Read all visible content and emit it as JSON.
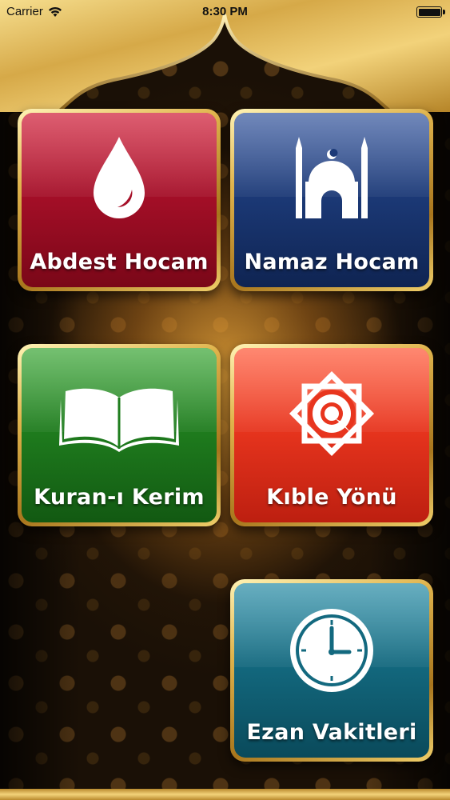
{
  "status_bar": {
    "carrier": "Carrier",
    "time": "8:30 PM"
  },
  "tiles": [
    {
      "label": "Abdest Hocam",
      "icon": "water-drop-icon",
      "color": "#a60f28"
    },
    {
      "label": "Namaz Hocam",
      "icon": "mosque-icon",
      "color": "#1c3a78"
    },
    {
      "label": "Kuran-ı Kerim",
      "icon": "open-book-icon",
      "color": "#1f7d1e"
    },
    {
      "label": "Kıble Yönü",
      "icon": "compass-star-icon",
      "color": "#e8351e"
    },
    {
      "label": "Ezan Vakitleri",
      "icon": "clock-icon",
      "color": "#13697f"
    }
  ],
  "colors": {
    "gold": "#e0b44d",
    "background": "#1a1006"
  }
}
